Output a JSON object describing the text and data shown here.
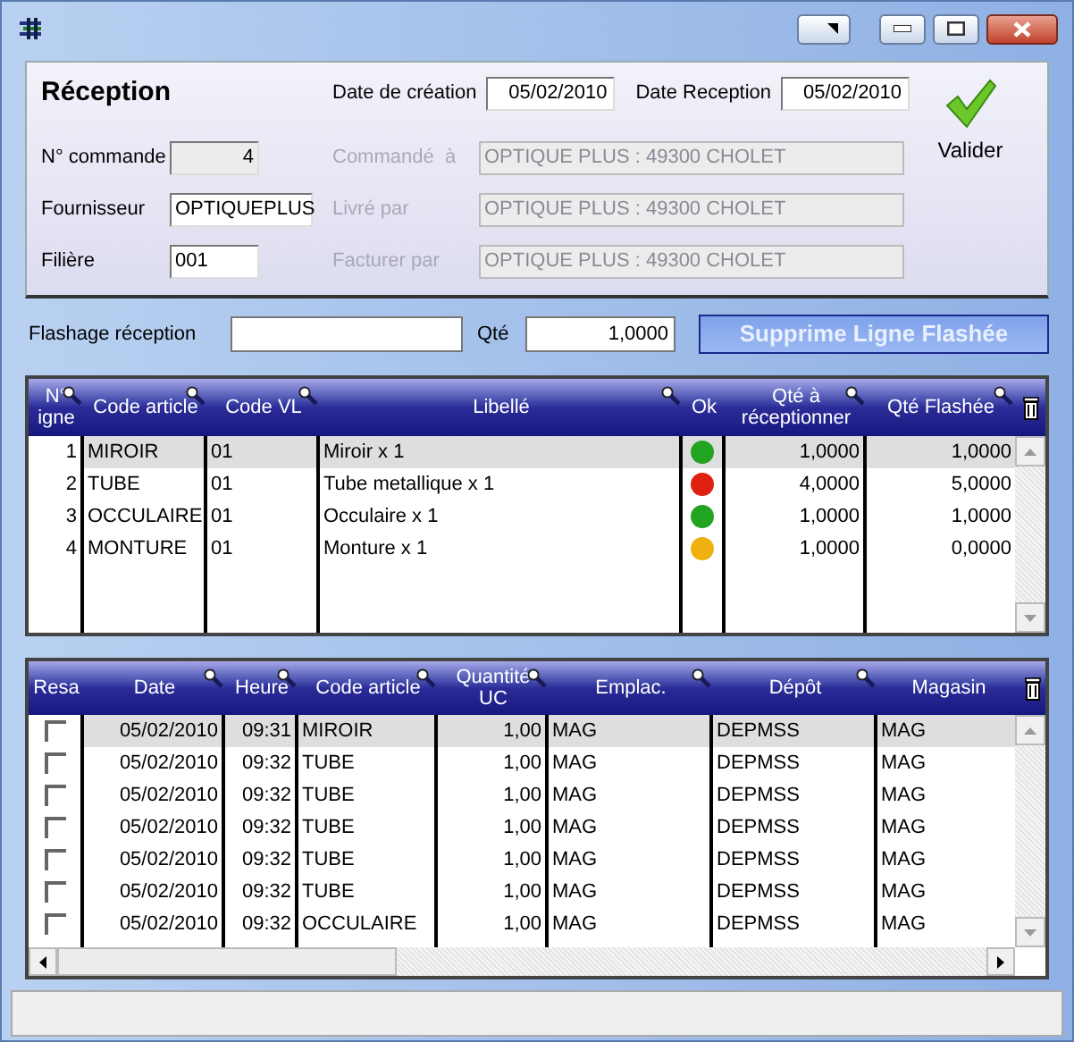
{
  "header": {
    "title": "Réception",
    "dates": [
      {
        "label": "Date de création",
        "value": "05/02/2010"
      },
      {
        "label": "Date Reception",
        "value": "05/02/2010"
      }
    ],
    "validate_button": "Valider"
  },
  "fields": [
    {
      "label": "N° commande",
      "value": "4",
      "kind": "readonly"
    },
    {
      "label": "Fournisseur",
      "value": "OPTIQUEPLUS",
      "kind": "editable"
    },
    {
      "label": "Filière",
      "value": "001",
      "kind": "editable"
    }
  ],
  "parties": [
    {
      "label": "Commandé  à",
      "value": "OPTIQUE PLUS : 49300 CHOLET",
      "disabled": true
    },
    {
      "label": "Livré par",
      "value": "OPTIQUE PLUS : 49300 CHOLET",
      "disabled": true
    },
    {
      "label": "Facturer par",
      "value": "OPTIQUE PLUS : 49300 CHOLET",
      "disabled": true
    }
  ],
  "flash": {
    "label": "Flashage réception",
    "qty_label": "Qté",
    "qty": "1,0000",
    "delete_button": "Supprime Ligne Flashée"
  },
  "lines_table": {
    "columns": [
      {
        "label": "N°\nigne",
        "searchable": true
      },
      {
        "label": "Code article",
        "searchable": true
      },
      {
        "label": "Code VL",
        "searchable": true
      },
      {
        "label": "Libellé",
        "searchable": true
      },
      {
        "label": "Ok",
        "searchable": false
      },
      {
        "label": "Qté à\nréceptionner",
        "searchable": true
      },
      {
        "label": "Qté Flashée",
        "searchable": true
      }
    ],
    "rows": [
      {
        "line": "1",
        "code_article": "MIROIR",
        "code_vl": "01",
        "libelle": "Miroir x 1",
        "color": "#22a322",
        "qte_a_receptionner": "1,0000",
        "qte_flashee": "1,0000",
        "selected": true
      },
      {
        "line": "2",
        "code_article": "TUBE",
        "code_vl": "01",
        "libelle": "Tube metallique x 1",
        "color": "#e02010",
        "qte_a_receptionner": "4,0000",
        "qte_flashee": "5,0000",
        "selected": false
      },
      {
        "line": "3",
        "code_article": "OCCULAIRE",
        "code_vl": "01",
        "libelle": "Occulaire x 1",
        "color": "#22a322",
        "qte_a_receptionner": "1,0000",
        "qte_flashee": "1,0000",
        "selected": false
      },
      {
        "line": "4",
        "code_article": "MONTURE",
        "code_vl": "01",
        "libelle": "Monture x 1",
        "color": "#f0b010",
        "qte_a_receptionner": "1,0000",
        "qte_flashee": "0,0000",
        "selected": false
      }
    ]
  },
  "movements_table": {
    "columns": [
      {
        "label": "Resa",
        "searchable": false
      },
      {
        "label": "Date",
        "searchable": true
      },
      {
        "label": "Heure",
        "searchable": true
      },
      {
        "label": "Code article",
        "searchable": true
      },
      {
        "label": "Quantité\nUC",
        "searchable": true
      },
      {
        "label": "Emplac.",
        "searchable": true
      },
      {
        "label": "Dépôt",
        "searchable": true
      },
      {
        "label": "Magasin",
        "searchable": false
      }
    ],
    "rows": [
      {
        "resa": false,
        "date": "05/02/2010",
        "heure": "09:31",
        "code_article": "MIROIR",
        "quantite": "1,00",
        "emplac": "MAG",
        "depot": "DEPMSS",
        "magasin": "MAG",
        "selected": true
      },
      {
        "resa": false,
        "date": "05/02/2010",
        "heure": "09:32",
        "code_article": "TUBE",
        "quantite": "1,00",
        "emplac": "MAG",
        "depot": "DEPMSS",
        "magasin": "MAG",
        "selected": false
      },
      {
        "resa": false,
        "date": "05/02/2010",
        "heure": "09:32",
        "code_article": "TUBE",
        "quantite": "1,00",
        "emplac": "MAG",
        "depot": "DEPMSS",
        "magasin": "MAG",
        "selected": false
      },
      {
        "resa": false,
        "date": "05/02/2010",
        "heure": "09:32",
        "code_article": "TUBE",
        "quantite": "1,00",
        "emplac": "MAG",
        "depot": "DEPMSS",
        "magasin": "MAG",
        "selected": false
      },
      {
        "resa": false,
        "date": "05/02/2010",
        "heure": "09:32",
        "code_article": "TUBE",
        "quantite": "1,00",
        "emplac": "MAG",
        "depot": "DEPMSS",
        "magasin": "MAG",
        "selected": false
      },
      {
        "resa": false,
        "date": "05/02/2010",
        "heure": "09:32",
        "code_article": "TUBE",
        "quantite": "1,00",
        "emplac": "MAG",
        "depot": "DEPMSS",
        "magasin": "MAG",
        "selected": false
      },
      {
        "resa": false,
        "date": "05/02/2010",
        "heure": "09:32",
        "code_article": "OCCULAIRE",
        "quantite": "1,00",
        "emplac": "MAG",
        "depot": "DEPMSS",
        "magasin": "MAG",
        "selected": false
      }
    ]
  }
}
